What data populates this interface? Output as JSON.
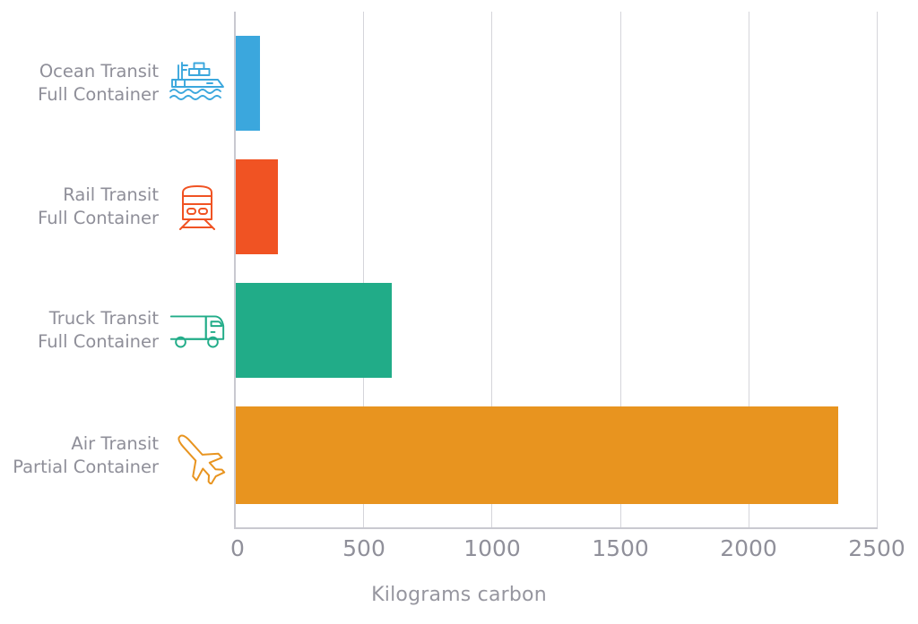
{
  "chart_data": {
    "type": "bar",
    "orientation": "horizontal",
    "title": "",
    "subtitle": "",
    "xlabel": "Kilograms carbon",
    "ylabel": "",
    "xlim": [
      0,
      2500
    ],
    "xticks": [
      0,
      500,
      1000,
      1500,
      2000,
      2500
    ],
    "xtick_labels": [
      "0",
      "500",
      "1000",
      "1500",
      "2000",
      "2500"
    ],
    "grid": "vertical",
    "legend": "none",
    "categories": [
      "Ocean Transit\nFull Container",
      "Rail Transit\nFull Container",
      "Truck Transit\nFull Container",
      "Air Transit\nPartial Container"
    ],
    "values": [
      99,
      166,
      610,
      2350
    ],
    "bar_colors": [
      "#3ba7dd",
      "#f05323",
      "#21ac88",
      "#e8941f"
    ],
    "bars": [
      {
        "label_line1": "Ocean Transit",
        "label_line2": "Full Container",
        "value": 99,
        "color": "#3ba7dd",
        "icon": "cargo-ship-icon"
      },
      {
        "label_line1": "Rail Transit",
        "label_line2": "Full Container",
        "value": 166,
        "color": "#f05323",
        "icon": "train-icon"
      },
      {
        "label_line1": "Truck Transit",
        "label_line2": "Full Container",
        "value": 610,
        "color": "#21ac88",
        "icon": "truck-icon"
      },
      {
        "label_line1": "Air Transit",
        "label_line2": "Partial Container",
        "value": 2350,
        "color": "#e8941f",
        "icon": "airplane-icon"
      }
    ]
  },
  "axis": {
    "x_title": "Kilograms carbon",
    "ticks": [
      "0",
      "500",
      "1000",
      "1500",
      "2000",
      "2500"
    ]
  },
  "colors": {
    "background": "#ffffff",
    "grid": "#d5d5da",
    "axis": "#c9c9d0",
    "label_text": "#8f8f99",
    "tick_text": "#90909a",
    "title_text": "#96969f",
    "ocean": "#3ba7dd",
    "rail": "#f05323",
    "truck": "#21ac88",
    "air": "#e8941f"
  }
}
